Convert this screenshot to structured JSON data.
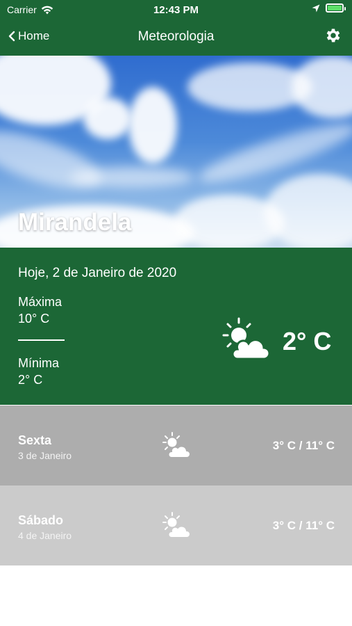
{
  "status_bar": {
    "carrier": "Carrier",
    "time": "12:43 PM",
    "battery_color": "#5de06a"
  },
  "nav": {
    "back_label": "Home",
    "title": "Meteorologia",
    "settings_icon": "gear-icon"
  },
  "hero": {
    "city": "Mirandela"
  },
  "today": {
    "date": "Hoje, 2 de Janeiro de 2020",
    "max_label": "Máxima",
    "max_value": "10° C",
    "min_label": "Mínima",
    "min_value": "2° C",
    "current_temp": "2° C",
    "icon": "partly-cloudy-icon"
  },
  "forecast": [
    {
      "day": "Sexta",
      "date": "3 de Janeiro",
      "range": "3° C / 11° C",
      "icon": "partly-cloudy-icon"
    },
    {
      "day": "Sábado",
      "date": "4 de Janeiro",
      "range": "3° C / 11° C",
      "icon": "partly-cloudy-icon"
    }
  ],
  "colors": {
    "brand_green": "#1c6736",
    "row_dark": "#adadad",
    "row_light": "#cbcbcb"
  }
}
